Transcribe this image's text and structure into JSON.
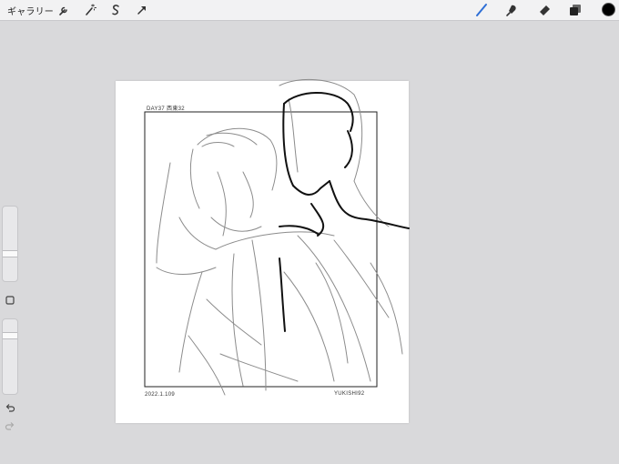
{
  "toolbar": {
    "gallery_label": "ギャラリー",
    "left_tools": [
      "wrench-icon",
      "magic-wand-icon",
      "selection-icon",
      "transform-icon"
    ],
    "right_tools": [
      "brush-icon",
      "smudge-icon",
      "eraser-icon",
      "layers-icon"
    ],
    "active_tool": "brush-icon",
    "accent_color": "#2f6fd6",
    "current_color": "#000000"
  },
  "sidebar": {
    "brush_size_level": 0.2,
    "opacity_level": 0.1,
    "modify_button": "square-icon",
    "undo": "undo-icon",
    "redo": "redo-icon"
  },
  "canvas": {
    "header_text": "DAY37 西東32",
    "date_text": "2022.1.109",
    "signature_text": "YUKISHI92",
    "background": "#ffffff"
  }
}
